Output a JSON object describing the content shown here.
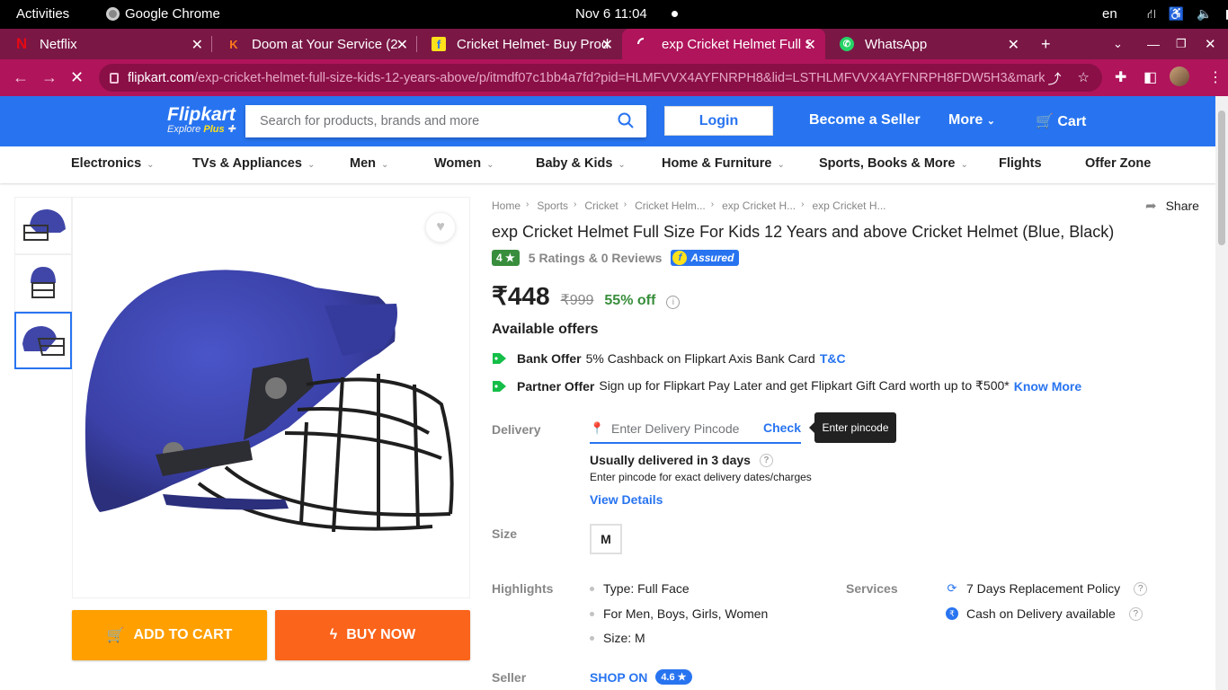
{
  "system_bar": {
    "activities": "Activities",
    "app_name": "Google Chrome",
    "clock": "Nov 6  11:04",
    "language": "en"
  },
  "tabs": [
    {
      "title": "Netflix",
      "favicon": "netflix-icon"
    },
    {
      "title": "Doom at Your Service (2",
      "favicon": "kdrama-icon"
    },
    {
      "title": "Cricket Helmet- Buy Prod",
      "favicon": "flipkart-icon"
    },
    {
      "title": "exp Cricket Helmet Full S",
      "favicon": "loading-icon",
      "active": true
    },
    {
      "title": "WhatsApp",
      "favicon": "whatsapp-icon"
    }
  ],
  "omnibox": {
    "domain": "flipkart.com",
    "path": "/exp-cricket-helmet-full-size-kids-12-years-above/p/itmdf07c1bb4a7fd?pid=HLMFVVX4AYFNRPH8&lid=LSTHLMFVVX4AYFNRPH8FDW5H3&marketp..."
  },
  "header": {
    "logo": "Flipkart",
    "logo_sub": "Explore",
    "logo_plus": "Plus",
    "search_placeholder": "Search for products, brands and more",
    "login": "Login",
    "become_seller": "Become a Seller",
    "more": "More",
    "cart": "Cart",
    "accent": "#2874f0"
  },
  "categories": [
    {
      "label": "Electronics",
      "chevron": true
    },
    {
      "label": "TVs & Appliances",
      "chevron": true
    },
    {
      "label": "Men",
      "chevron": true
    },
    {
      "label": "Women",
      "chevron": true
    },
    {
      "label": "Baby & Kids",
      "chevron": true
    },
    {
      "label": "Home & Furniture",
      "chevron": true
    },
    {
      "label": "Sports, Books & More",
      "chevron": true
    },
    {
      "label": "Flights",
      "chevron": false
    },
    {
      "label": "Offer Zone",
      "chevron": false
    }
  ],
  "breadcrumbs": [
    "Home",
    "Sports",
    "Cricket",
    "Cricket Helm...",
    "exp Cricket H...",
    "exp Cricket H..."
  ],
  "share": "Share",
  "product": {
    "title": "exp Cricket Helmet Full Size For Kids 12 Years and above Cricket Helmet  (Blue, Black)",
    "rating": "4",
    "rating_text": "5 Ratings & 0 Reviews",
    "assured": "Assured",
    "price": "₹448",
    "mrp": "₹999",
    "discount": "55% off"
  },
  "buttons": {
    "add_to_cart": "ADD TO CART",
    "buy_now": "BUY NOW"
  },
  "offers": {
    "heading": "Available offers",
    "items": [
      {
        "type": "Bank Offer",
        "text": "5% Cashback on Flipkart Axis Bank Card",
        "link": "T&C"
      },
      {
        "type": "Partner Offer",
        "text": "Sign up for Flipkart Pay Later and get Flipkart Gift Card worth up to ₹500*",
        "link": "Know More"
      }
    ]
  },
  "delivery": {
    "label": "Delivery",
    "placeholder": "Enter Delivery Pincode",
    "check": "Check",
    "tooltip": "Enter pincode",
    "usually": "Usually delivered in 3 days",
    "sub": "Enter pincode for exact delivery dates/charges",
    "view_details": "View Details"
  },
  "size": {
    "label": "Size",
    "value": "M"
  },
  "highlights": {
    "label": "Highlights",
    "items": [
      "Type: Full Face",
      "For Men, Boys, Girls, Women",
      "Size: M"
    ]
  },
  "services": {
    "label": "Services",
    "items": [
      "7 Days Replacement Policy",
      "Cash on Delivery available"
    ]
  },
  "seller": {
    "label": "Seller",
    "name": "SHOP ON",
    "rating": "4.6 ★"
  }
}
